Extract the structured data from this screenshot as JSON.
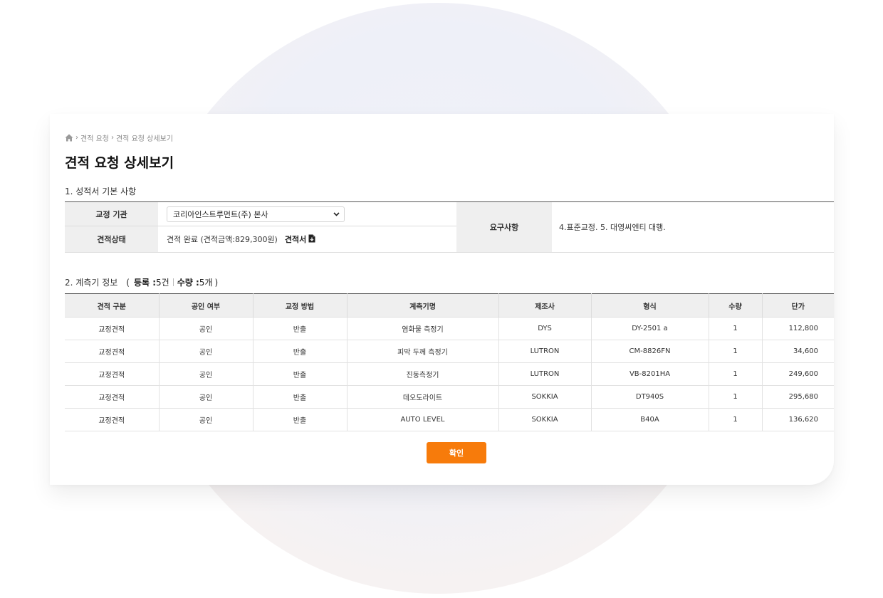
{
  "breadcrumb": {
    "items": [
      "견적 요청",
      "견적 요청 상세보기"
    ]
  },
  "page": {
    "title": "견적 요청 상세보기"
  },
  "section1": {
    "title": "1. 성적서 기본 사항",
    "institution_label": "교정 기관",
    "institution_value": "코리아인스트루먼트(주) 본사",
    "status_label": "견적상태",
    "status_value": "견적 완료 (견적금액:829,300원)",
    "document_link": "견적서",
    "requirements_label": "요구사항",
    "requirements_value": "4.표준교정. 5. 대영씨엔티 대행."
  },
  "section2": {
    "title": "2. 계측기 정보",
    "open_paren": "(",
    "registered_label": "등록 : ",
    "registered_value": "5건",
    "quantity_label": "수량 : ",
    "quantity_value": "5개",
    "close_paren": ")",
    "columns": [
      "견적 구분",
      "공인 여부",
      "교정 방법",
      "계측기명",
      "제조사",
      "형식",
      "수량",
      "단가"
    ],
    "rows": [
      [
        "교정견적",
        "공인",
        "반출",
        "염화물 측정기",
        "DYS",
        "DY-2501 a",
        "1",
        "112,800"
      ],
      [
        "교정견적",
        "공인",
        "반출",
        "피막 두께 측정기",
        "LUTRON",
        "CM-8826FN",
        "1",
        "34,600"
      ],
      [
        "교정견적",
        "공인",
        "반출",
        "진동측정기",
        "LUTRON",
        "VB-8201HA",
        "1",
        "249,600"
      ],
      [
        "교정견적",
        "공인",
        "반출",
        "데오도라이트",
        "SOKKIA",
        "DT940S",
        "1",
        "295,680"
      ],
      [
        "교정견적",
        "공인",
        "반출",
        "AUTO LEVEL",
        "SOKKIA",
        "B40A",
        "1",
        "136,620"
      ]
    ]
  },
  "actions": {
    "confirm_label": "확인"
  },
  "colors": {
    "accent": "#f77b0b",
    "label_bg": "#efefef"
  },
  "icons": {
    "home": "home-icon",
    "chevron": "chevron-right-icon",
    "dropdown": "chevron-down-icon",
    "document": "document-download-icon"
  }
}
